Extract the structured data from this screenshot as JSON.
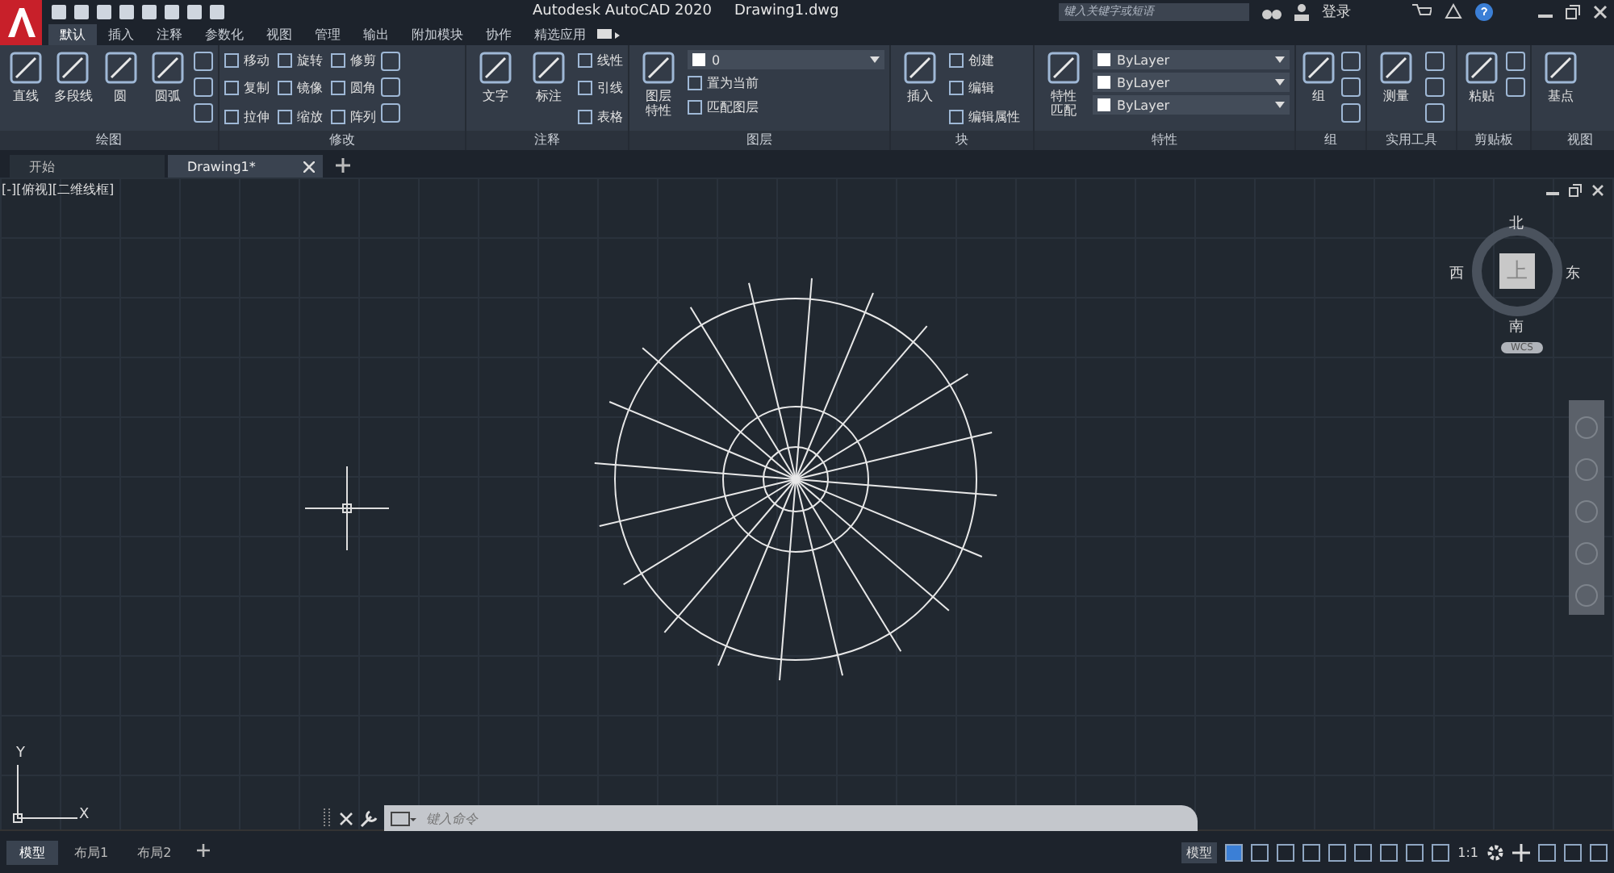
{
  "title_bar": {
    "app_name": "Autodesk AutoCAD 2020",
    "file_name": "Drawing1.dwg",
    "search": {
      "placeholder": "键入关键字或短语"
    },
    "login": "登录"
  },
  "menu_tabs": [
    {
      "label": "默认",
      "selected": true
    },
    {
      "label": "插入",
      "selected": false
    },
    {
      "label": "注释",
      "selected": false
    },
    {
      "label": "参数化",
      "selected": false
    },
    {
      "label": "视图",
      "selected": false
    },
    {
      "label": "管理",
      "selected": false
    },
    {
      "label": "输出",
      "selected": false
    },
    {
      "label": "附加模块",
      "selected": false
    },
    {
      "label": "协作",
      "selected": false
    },
    {
      "label": "精选应用",
      "selected": false
    }
  ],
  "ribbon_panels": [
    {
      "title": "绘图",
      "large": [
        "直线",
        "多段线",
        "圆",
        "圆弧"
      ]
    },
    {
      "title": "修改",
      "small": [
        "移动",
        "旋转",
        "修剪",
        "复制",
        "镜像",
        "圆角",
        "拉伸",
        "缩放",
        "阵列"
      ]
    },
    {
      "title": "注释",
      "large": [
        "文字",
        "标注"
      ],
      "small": [
        "线性",
        "引线",
        "表格"
      ]
    },
    {
      "title": "图层",
      "large": [
        "图层特性"
      ],
      "small": [
        "置为当前",
        "匹配图层"
      ],
      "dropdowns": [
        "0"
      ]
    },
    {
      "title": "块",
      "large": [
        "插入"
      ],
      "small": [
        "创建",
        "编辑",
        "编辑属性"
      ]
    },
    {
      "title": "特性",
      "large": [
        "特性匹配"
      ],
      "dropdowns": [
        "ByLayer",
        "ByLayer",
        "ByLayer"
      ]
    },
    {
      "title": "组",
      "large": [
        "组"
      ]
    },
    {
      "title": "实用工具",
      "large": [
        "测量"
      ]
    },
    {
      "title": "剪贴板",
      "large": [
        "粘贴"
      ]
    },
    {
      "title": "视图",
      "large": [
        "基点"
      ]
    }
  ],
  "doc_tabs": [
    {
      "label": "开始",
      "selected": false
    },
    {
      "label": "Drawing1*",
      "selected": true
    }
  ],
  "viewport": {
    "label": "[-][俯视][二维线框]",
    "viewcube": {
      "north": "北",
      "east": "东",
      "south": "南",
      "west": "西",
      "face": "上",
      "wcs": "WCS"
    },
    "ucs": {
      "x": "X",
      "y": "Y"
    }
  },
  "command_line": {
    "placeholder": "键入命令"
  },
  "layout_tabs": [
    {
      "label": "模型",
      "selected": true
    },
    {
      "label": "布局1",
      "selected": false
    },
    {
      "label": "布局2",
      "selected": false
    }
  ],
  "status_bar": {
    "model": "模型",
    "scale": "1:1"
  }
}
